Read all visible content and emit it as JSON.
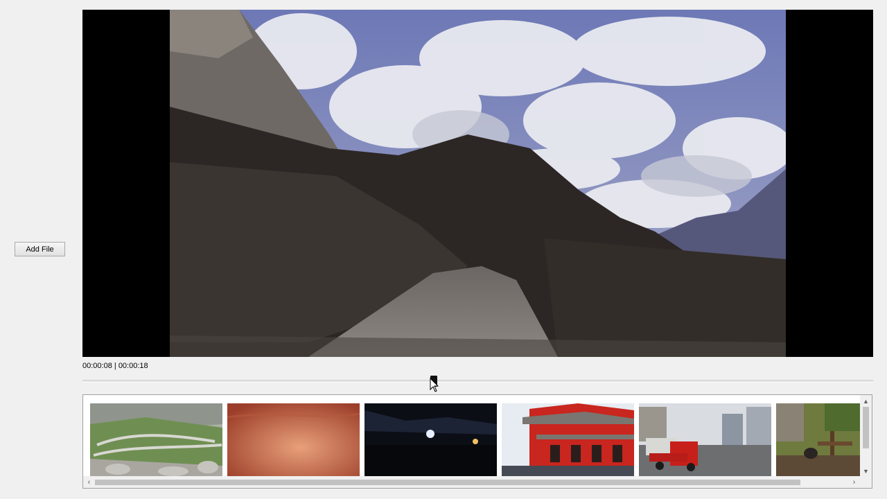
{
  "sidebar": {
    "add_file_label": "Add File"
  },
  "player": {
    "current_time": "00:00:08",
    "separator": " | ",
    "total_time": "00:00:18",
    "progress_fraction": 0.44
  },
  "thumbnails": [
    {
      "subject": "mountain-pass-road"
    },
    {
      "subject": "close-up-skin"
    },
    {
      "subject": "night-crowd"
    },
    {
      "subject": "red-temple"
    },
    {
      "subject": "street-truck"
    },
    {
      "subject": "zoo-panda"
    }
  ],
  "scrollbars": {
    "up_glyph": "▲",
    "down_glyph": "▼",
    "left_glyph": "‹",
    "right_glyph": "›"
  }
}
